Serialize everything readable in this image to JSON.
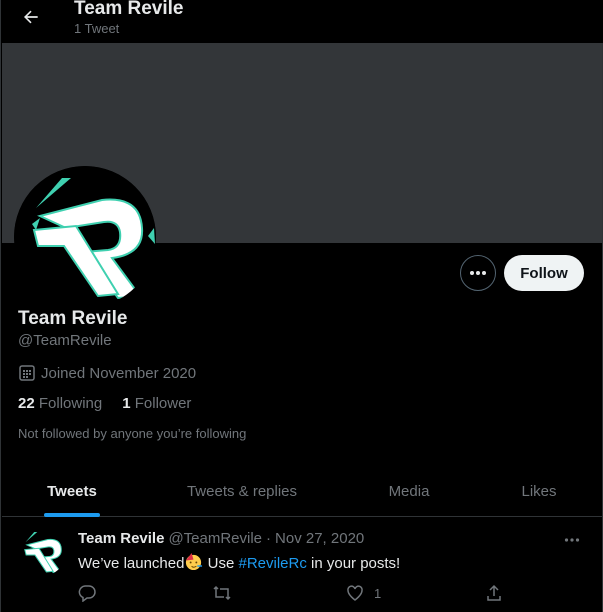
{
  "header": {
    "title": "Team Revile",
    "subtitle": "1 Tweet"
  },
  "profile": {
    "name": "Team Revile",
    "handle": "@TeamRevile",
    "joined": "Joined November 2020",
    "following_count": "22",
    "following_label": "Following",
    "followers_count": "1",
    "followers_label": "Follower",
    "not_followed": "Not followed by anyone you’re following",
    "follow_label": "Follow"
  },
  "tabs": [
    {
      "label": "Tweets",
      "active": true
    },
    {
      "label": "Tweets & replies",
      "active": false
    },
    {
      "label": "Media",
      "active": false
    },
    {
      "label": "Likes",
      "active": false
    }
  ],
  "tweet": {
    "name": "Team Revile",
    "handle": "@TeamRevile",
    "separator": "·",
    "date": "Nov 27, 2020",
    "text_before": "We’ve launched",
    "text_mid": " Use ",
    "hashtag": "#RevileRc",
    "text_after": " in your posts!",
    "like_count": "1"
  },
  "colors": {
    "background": "#000000",
    "banner": "#333639",
    "accent": "#1d9bf0",
    "muted": "#71767b",
    "logo_accent": "#3fd0b0"
  },
  "icons": [
    "back-arrow-icon",
    "more-icon",
    "calendar-icon",
    "reply-icon",
    "retweet-icon",
    "like-icon",
    "share-icon",
    "party-face-emoji"
  ]
}
